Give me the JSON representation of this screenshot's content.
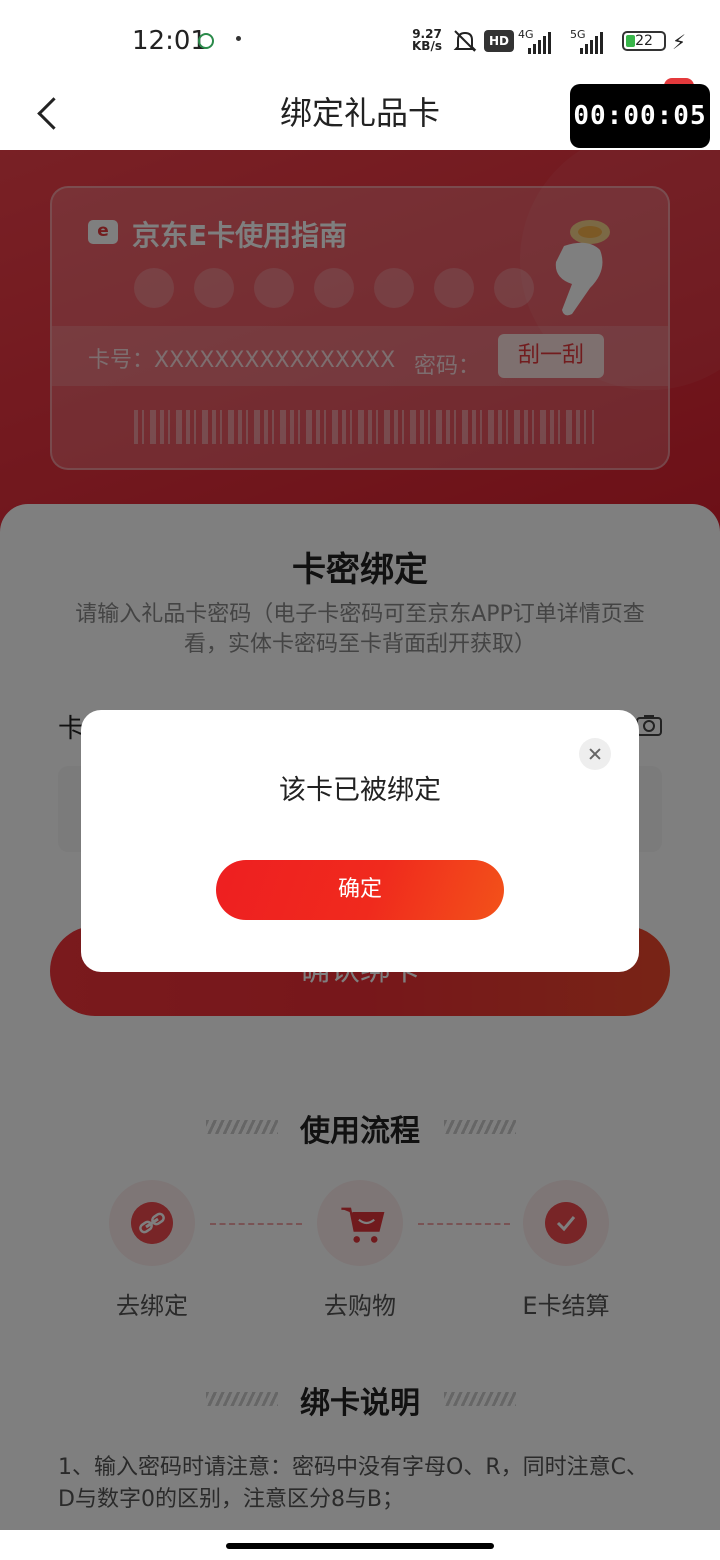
{
  "status_bar": {
    "time": "12:01",
    "net_speed_top": "9.27",
    "net_speed_bottom": "KB/s",
    "hd_label": "HD",
    "sig1_label": "4G",
    "sig2_label": "5G",
    "battery": "22"
  },
  "header": {
    "title": "绑定礼品卡",
    "timer": "00:00:05"
  },
  "guide_card": {
    "logo": "e",
    "title": "京东E卡使用指南",
    "card_no_label": "卡号：XXXXXXXXXXXXXXXX",
    "password_label": "密码：",
    "scratch_label": "刮一刮"
  },
  "bind_panel": {
    "title": "卡密绑定",
    "description": "请输入礼品卡密码（电子卡密码可至京东APP订单详情页查看，实体卡密码至卡背面刮开获取）",
    "password_field_label": "卡",
    "password_value": "",
    "confirm_button": "确认绑卡"
  },
  "process": {
    "title": "使用流程",
    "steps": [
      {
        "label": "去绑定",
        "icon": "link-icon"
      },
      {
        "label": "去购物",
        "icon": "cart-icon"
      },
      {
        "label": "E卡结算",
        "icon": "check-icon"
      }
    ]
  },
  "rules": {
    "title": "绑卡说明",
    "lines": [
      "1、输入密码时请注意：密码中没有字母O、R，同时注意C、D与数字0的区别，注意区分8与B；"
    ]
  },
  "dialog": {
    "message": "该卡已被绑定",
    "ok_button": "确定"
  },
  "colors": {
    "brand_red": "#e4393c",
    "overlay": "rgba(0,0,0,0.5)"
  }
}
